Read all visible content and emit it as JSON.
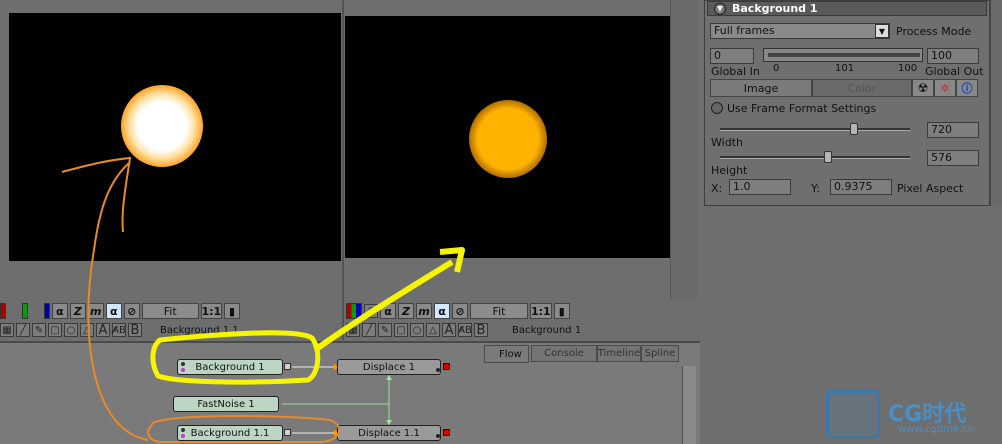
{
  "viewer_left": {
    "view_label": "Background 1.1",
    "fit": "Fit",
    "zoom": "1:1"
  },
  "viewer_right": {
    "view_label": "Background 1",
    "fit": "Fit",
    "zoom": "1:1"
  },
  "toolbar": {
    "alpha": "α",
    "z": "Z",
    "m": "m",
    "alpha2": "α",
    "a": "A",
    "b": "B",
    "ab": "A̸B"
  },
  "flow": {
    "title": "Flow",
    "tabs": [
      "Console",
      "Timeline",
      "Spline"
    ],
    "nodes": {
      "bg1": "Background 1",
      "disp1": "Displace 1",
      "noise": "FastNoise 1",
      "bg11": "Background 1.1",
      "disp11": "Displace 1.1"
    }
  },
  "inspector": {
    "title": "Background 1",
    "process_mode_value": "Full frames",
    "process_mode_label": "Process Mode",
    "global_in_value": "0",
    "global_out_value": "100",
    "range_start": "0",
    "range_mid": "101",
    "range_end": "100",
    "global_in_label": "Global In",
    "global_out_label": "Global Out",
    "tab_image": "Image",
    "tab_color": "Color",
    "use_frame_format": "Use Frame Format Settings",
    "width_label": "Width",
    "width_value": "720",
    "height_label": "Height",
    "height_value": "576",
    "x_label": "X:",
    "x_value": "1.0",
    "y_label": "Y:",
    "y_value": "0.9375",
    "pixel_aspect": "Pixel Aspect"
  },
  "watermark": {
    "brand": "CG时代",
    "url": "www.cgtime.cn"
  },
  "colors": {
    "orange_annotation": "#e88a2a",
    "yellow_annotation": "#f5f500",
    "glow_core": "#ffffff",
    "glow_orange": "#ffb300"
  }
}
